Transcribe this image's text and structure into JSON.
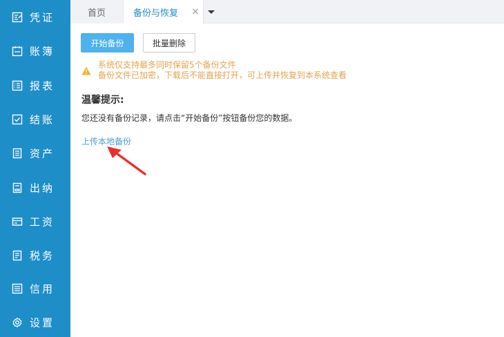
{
  "sidebar": {
    "items": [
      {
        "label": "凭证",
        "icon": "voucher-icon"
      },
      {
        "label": "账簿",
        "icon": "ledger-icon"
      },
      {
        "label": "报表",
        "icon": "report-icon"
      },
      {
        "label": "结账",
        "icon": "checkout-icon"
      },
      {
        "label": "资产",
        "icon": "asset-icon"
      },
      {
        "label": "出纳",
        "icon": "cashier-icon"
      },
      {
        "label": "工资",
        "icon": "payroll-icon"
      },
      {
        "label": "税务",
        "icon": "tax-icon"
      },
      {
        "label": "信用",
        "icon": "credit-icon"
      },
      {
        "label": "设置",
        "icon": "gear-icon"
      }
    ]
  },
  "tabs": {
    "home": "首页",
    "active": "备份与恢复",
    "close_symbol": "×"
  },
  "main": {
    "start_backup": "开始备份",
    "batch_delete": "批量删除",
    "warning_line1": "系统仅支持最多同时保留5个备份文件",
    "warning_line2": "备份文件已加密，下载后不能直接打开，可上传并恢复到本系统查看",
    "tips_title": "温馨提示:",
    "tips_body": "您还没有备份记录，请点击“开始备份”按钮备份您的数据。",
    "upload_link": "上传本地备份"
  },
  "colors": {
    "sidebar_bg": "#1e8ec9",
    "primary_button": "#4db2ee",
    "warning": "#e8a24d",
    "link": "#4a9fdb",
    "annotation_arrow": "#e8312f"
  }
}
